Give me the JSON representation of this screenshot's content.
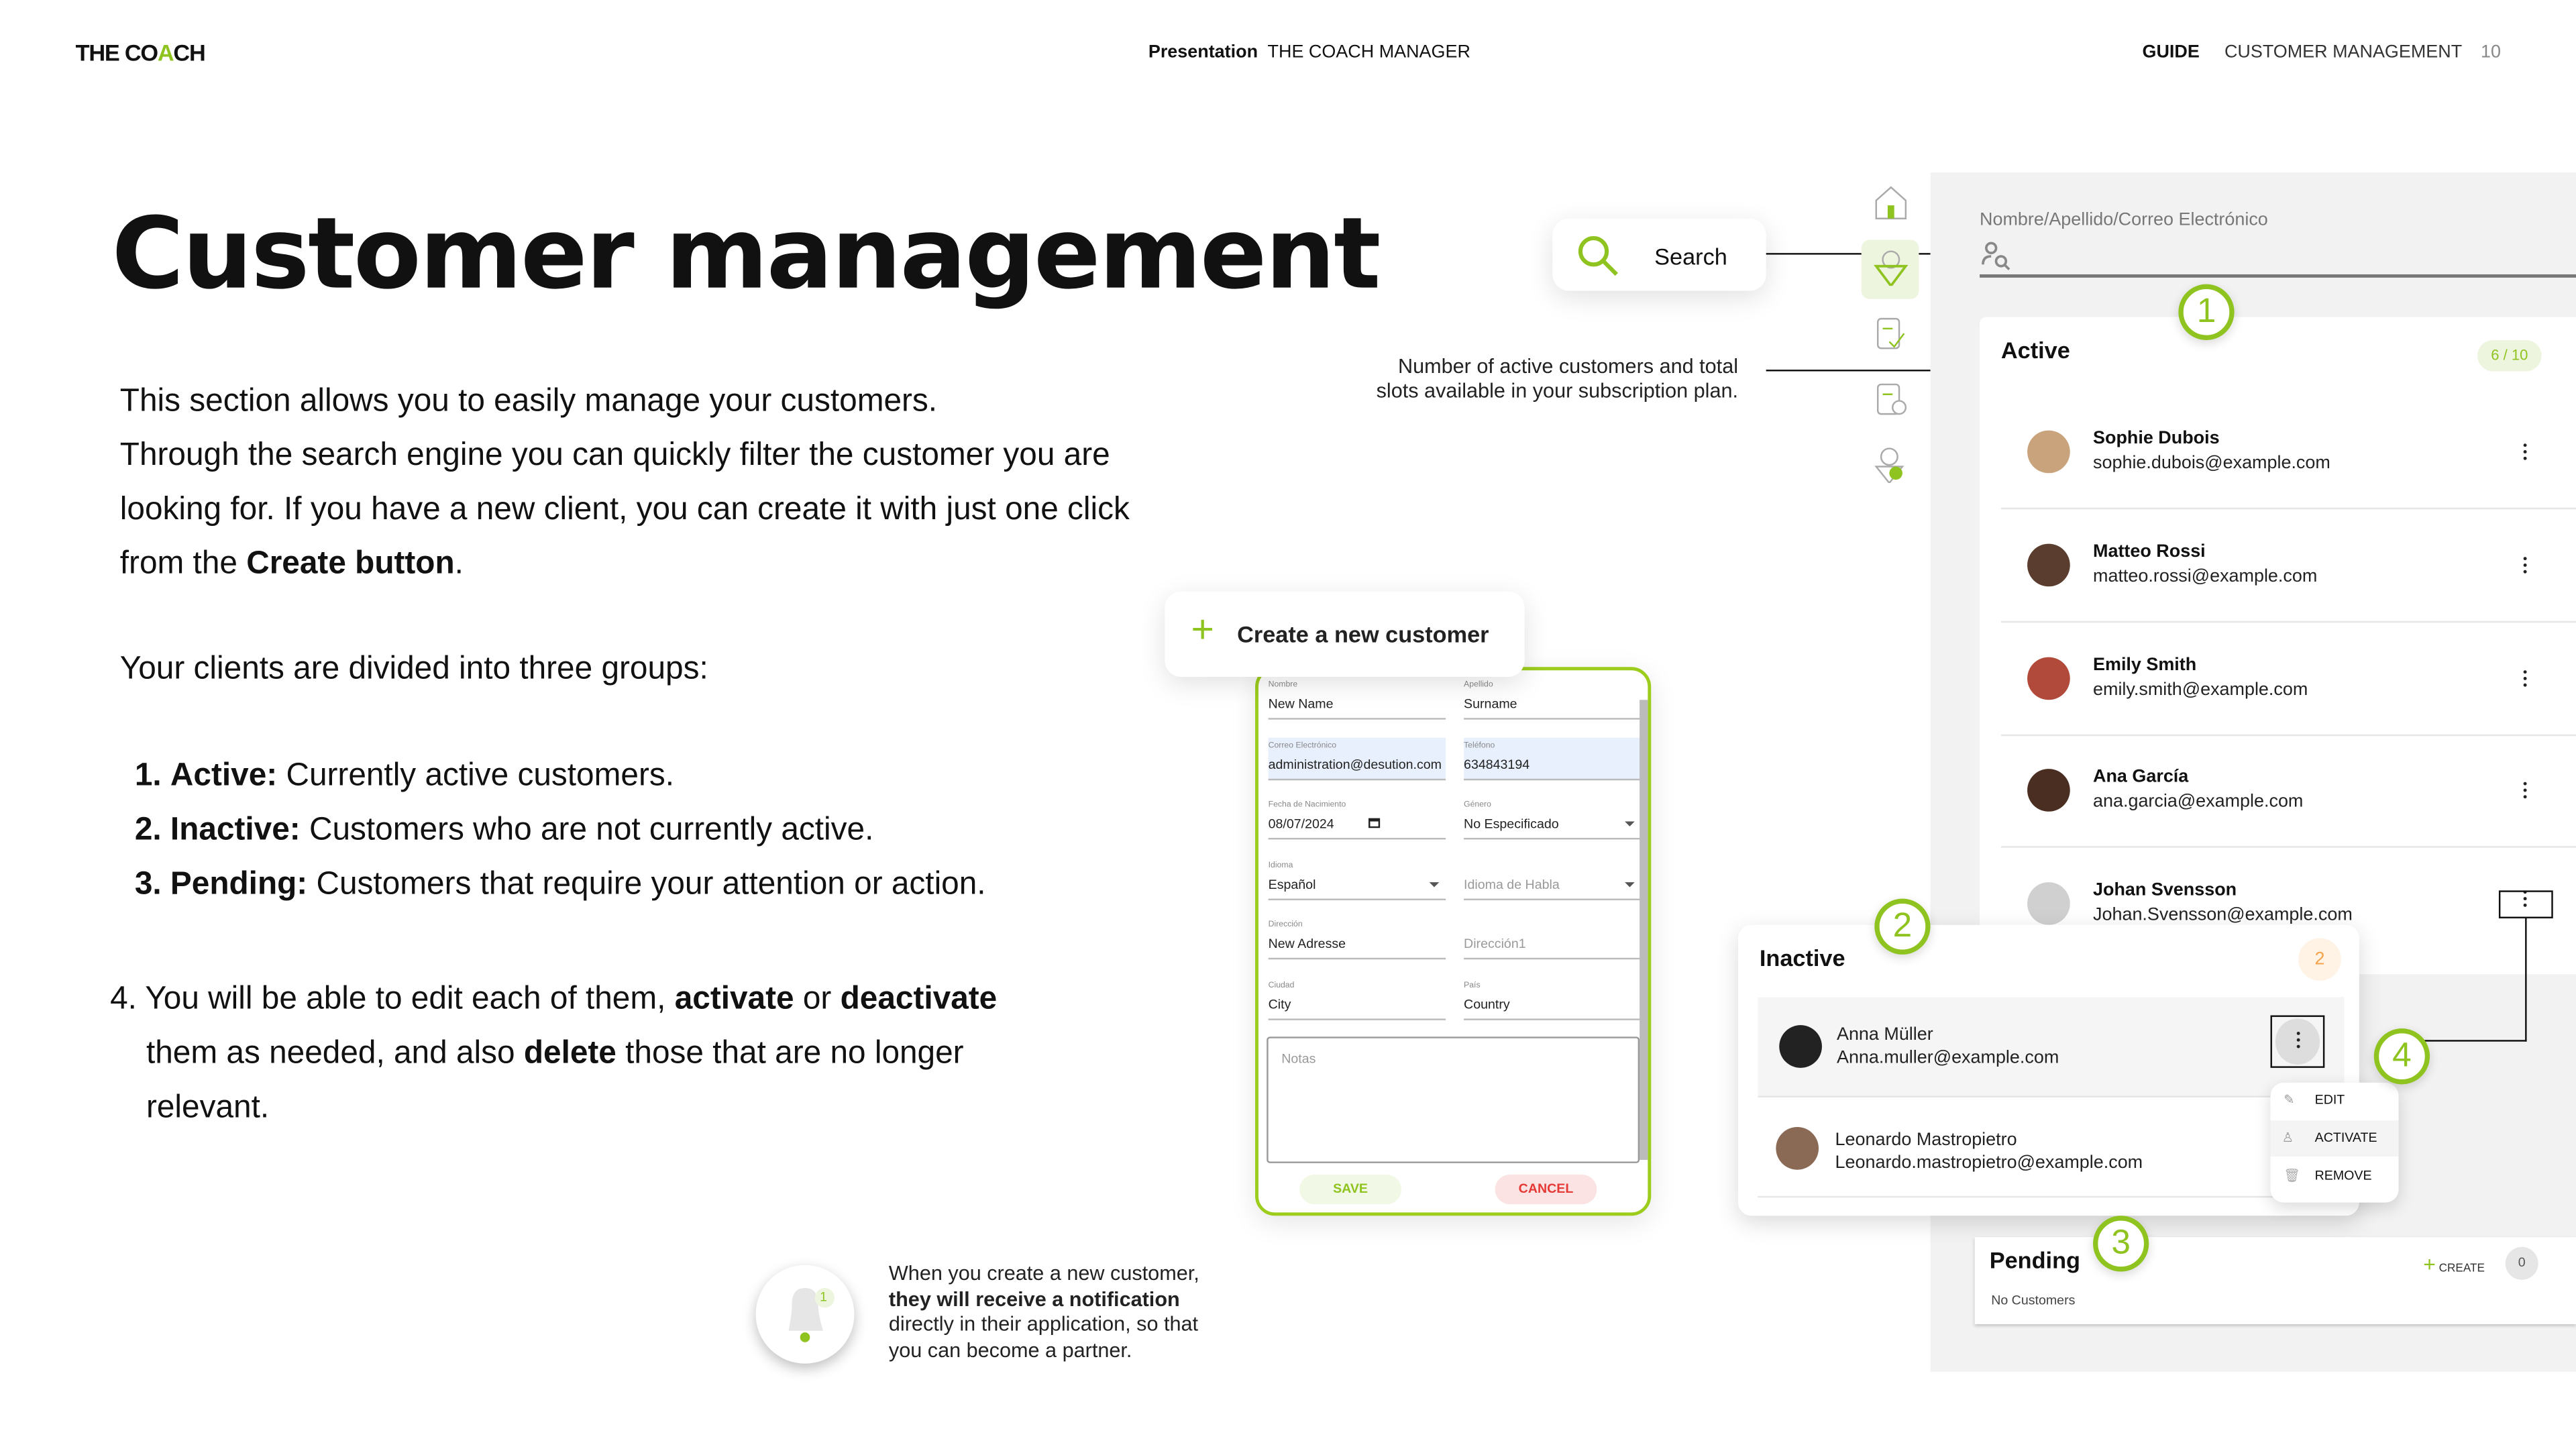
{
  "header": {
    "logo": "THE COACH",
    "presentation_label": "Presentation",
    "presentation_name": "THE COACH MANAGER",
    "guide_label": "GUIDE",
    "section": "CUSTOMER MANAGEMENT",
    "page_number": "10"
  },
  "title": "Customer management",
  "intro": {
    "line1": "This section allows you to easily manage your customers.",
    "line2": "Through the search engine you can quickly filter the customer you are",
    "line3": "looking for. If you have a new client, you can create it with just one click",
    "line4_pre": "from the ",
    "line4_bold": "Create button",
    "line4_post": "."
  },
  "groups_intro": "Your clients are divided into three groups:",
  "groups": [
    {
      "num": "1.",
      "name": "Active:",
      "desc": " Currently active customers."
    },
    {
      "num": "2.",
      "name": "Inactive:",
      "desc": " Customers who are not currently active."
    },
    {
      "num": "3.",
      "name": "Pending:",
      "desc": " Customers that require your attention or action."
    }
  ],
  "point4": {
    "pre": "4. You will be able to edit each of them, ",
    "b1": "activate",
    "mid": " or ",
    "b2": "deactivate",
    "line2_pre": "them as needed, and also ",
    "b3": "delete",
    "line2_post": " those that are no longer",
    "line3": "relevant."
  },
  "search_callout": {
    "label": "Search"
  },
  "active_annotation": {
    "line1": "Number of active customers and total",
    "line2": "slots available in your subscription plan."
  },
  "create_button": {
    "label": "Create a new customer"
  },
  "form": {
    "fields": [
      {
        "label": "Nombre",
        "value": "New Name"
      },
      {
        "label": "Apellido",
        "value": "Surname"
      },
      {
        "label": "Correo Electrónico",
        "value": "administration@desution.com"
      },
      {
        "label": "Teléfono",
        "value": "634843194"
      },
      {
        "label": "Fecha de Nacimiento",
        "value": "08/07/2024"
      },
      {
        "label": "Género",
        "value": "No Especificado"
      },
      {
        "label": "Idioma",
        "value": "Español"
      },
      {
        "label": "",
        "placeholder": "Idioma de Habla"
      },
      {
        "label": "Dirección",
        "value": "New Adresse"
      },
      {
        "label": "",
        "placeholder": "Dirección1"
      },
      {
        "label": "Ciudad",
        "value": "City"
      },
      {
        "label": "País",
        "value": "Country"
      }
    ],
    "notes_placeholder": "Notas",
    "save": "SAVE",
    "cancel": "CANCEL"
  },
  "notification": {
    "badge": "1",
    "line1": "When you create a new customer,",
    "line2": "they will receive a notification",
    "line3": "directly in their application, so that",
    "line4": "you can become a partner."
  },
  "app": {
    "search_label": "Nombre/Apellido/Correo Electrónico",
    "active": {
      "title": "Active",
      "count": "6 / 10",
      "customers": [
        {
          "name": "Sophie Dubois",
          "email": "sophie.dubois@example.com"
        },
        {
          "name": "Matteo Rossi",
          "email": "matteo.rossi@example.com"
        },
        {
          "name": "Emily Smith",
          "email": "emily.smith@example.com"
        },
        {
          "name": "Ana García",
          "email": "ana.garcia@example.com"
        },
        {
          "name": "Johan Svensson",
          "email": "Johan.Svensson@example.com"
        }
      ]
    },
    "inactive": {
      "title": "Inactive",
      "count": "2",
      "customers": [
        {
          "name": "Anna Müller",
          "email": "Anna.muller@example.com"
        },
        {
          "name": "Leonardo Mastropietro",
          "email": "Leonardo.mastropietro@example.com"
        }
      ]
    },
    "menu": {
      "edit": "EDIT",
      "activate": "ACTIVATE",
      "remove": "REMOVE"
    },
    "pending": {
      "title": "Pending",
      "create": "CREATE",
      "count": "0",
      "empty": "No Customers"
    }
  },
  "callouts": {
    "n1": "1",
    "n2": "2",
    "n3": "3",
    "n4": "4"
  },
  "colors": {
    "accent": "#8fc31f",
    "cancel": "#e53935",
    "inactive_badge": "#f5a34a"
  }
}
